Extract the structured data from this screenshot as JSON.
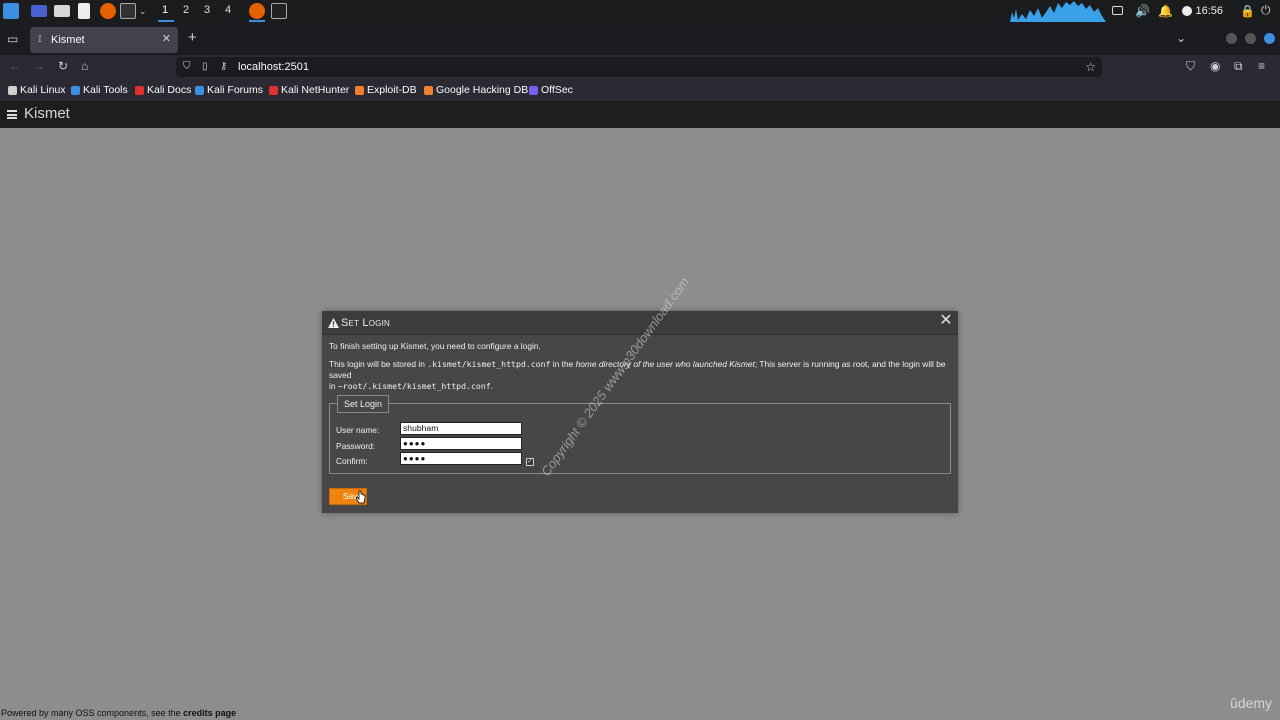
{
  "taskbar": {
    "workspaces": [
      "1",
      "2",
      "3",
      "4"
    ],
    "active_workspace": "1",
    "clock": "16:56",
    "icons": [
      "kali-menu-icon",
      "desktop-icon",
      "files-icon",
      "text-editor-icon",
      "firefox-icon",
      "terminal-icon",
      "firefox-running-icon",
      "terminal-running-icon"
    ]
  },
  "browser": {
    "tab": {
      "title": "Kismet"
    },
    "url": "localhost:2501",
    "bookmarks": [
      {
        "label": "Kali Linux",
        "color": "#cfcfcf"
      },
      {
        "label": "Kali Tools",
        "color": "#3d8fe0"
      },
      {
        "label": "Kali Docs",
        "color": "#e03030"
      },
      {
        "label": "Kali Forums",
        "color": "#3d8fe0"
      },
      {
        "label": "Kali NetHunter",
        "color": "#e03030"
      },
      {
        "label": "Exploit-DB",
        "color": "#f08030"
      },
      {
        "label": "Google Hacking DB",
        "color": "#f08030"
      },
      {
        "label": "OffSec",
        "color": "#7a5cf0"
      }
    ]
  },
  "app": {
    "title": "Kismet",
    "footer": {
      "text": "Powered by many OSS components, see the ",
      "link": "credits page"
    },
    "udemy_mark": "ûdemy"
  },
  "dialog": {
    "title": "Set Login",
    "intro": "To finish setting up Kismet, you need to configure a login.",
    "p2_a": "This login will be stored in ",
    "p2_path": ".kismet/kismet_httpd.conf",
    "p2_b": " in the ",
    "p2_em": "home directory of the user who launched Kismet",
    "p2_c": "; This server is running as root, and the login will be saved",
    "p2_d": "in ",
    "p2_path2": "~root/.kismet/kismet_httpd.conf",
    "p2_e": ".",
    "fieldset_legend": "Set Login",
    "fields": {
      "username_label": "User name:",
      "username_value": "shubham",
      "password_label": "Password:",
      "password_value": "●●●●",
      "confirm_label": "Confirm:",
      "confirm_value": "●●●●"
    },
    "save_label": "Save"
  },
  "watermark": "Copyright © 2025 www.p30download.com"
}
